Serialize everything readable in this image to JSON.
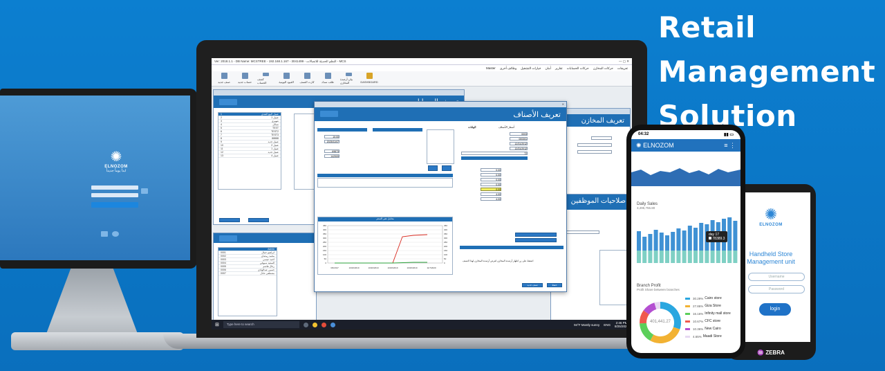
{
  "headline": [
    "Retail",
    "Management",
    "Solution"
  ],
  "monitor": {
    "logo_text": "ELNOZOM",
    "logo_sub": "ابدأ يوماً جديداً"
  },
  "laptop": {
    "window_title": "Ver: 2018.1.1 - DB Name: MCSTREE - 192.168.1.167 - 3041499 - النظم الحديثة للاتصالات - MCS",
    "menu": [
      "تعريفات",
      "حركات المخازن",
      "حركات الحسابات",
      "تقارير",
      "أمان",
      "خيارات التشغيل",
      "وظائف أخرى",
      "Master"
    ],
    "ribbon": [
      "صنف جديد",
      "حساب جديد",
      "كشف الحساب",
      "القيود اليومية",
      "كارت الصنف",
      "طلب سداد",
      "بيان أرصدة المخازن",
      "DASHBOARD"
    ],
    "accounts_window": {
      "title": "تعريف الحسابات",
      "rows": [
        [
          "1",
          "عميل البيع النقدي"
        ],
        [
          "2",
          "عميل 1"
        ],
        [
          "3",
          "شهيري"
        ],
        [
          "4",
          "نسائل"
        ],
        [
          "5",
          "TEST"
        ],
        [
          "6",
          "TEST2"
        ],
        [
          "7",
          "TEST3"
        ],
        [
          "8",
          "88888"
        ],
        [
          "9",
          "عميل جديد"
        ],
        [
          "10",
          "عميل 2"
        ],
        [
          "11",
          "عميل 1"
        ],
        [
          "12",
          "عميل جديد"
        ],
        [
          "13",
          "عميل 4"
        ]
      ]
    },
    "stores_window": {
      "title": "تعريف المخازن"
    },
    "items_window": {
      "title": "تعريف الأصناف",
      "tab_data": "البيانات",
      "tab_prices": "أسعار الأصناف",
      "item_code": "0003",
      "barcode": "000301",
      "date1": "12/31/2012",
      "date2": "12/31/2012",
      "qty": "72",
      "price_fields": [
        "0.00",
        "0.00",
        "0.00",
        "0.00",
        "0.00",
        "4.00",
        "4.00"
      ],
      "chart_title": "معامل تغير السعر",
      "chart_x": [
        "3/6/2017",
        "10/20/2019",
        "10/20/2019",
        "10/26/2019",
        "10/26/2019",
        "11/7/2020"
      ],
      "chart_y": [
        "0",
        "50",
        "100",
        "150",
        "200",
        "250",
        "300",
        "350",
        "400",
        "450"
      ],
      "stores_note": "اضغط على زر اظهار أرصدة المخازن لعرض أرصدة المخازن لهذا الصنف",
      "btn_save": "حفظ",
      "btn_new": "صنف جديد",
      "date_entry": "10:00",
      "entry_date": "2025/11/07",
      "stock": "69873",
      "stock2": "142909"
    },
    "employees_window": {
      "title": "صلاحيات الموظفين"
    },
    "users": [
      "Admin",
      "ابراهيم جمال",
      "محمد رمضان",
      "احمد عيسى",
      "السعيد سيوفي",
      "رجال هاشم",
      "حسين عبدالهادي",
      "مصطفى عادل"
    ],
    "users_codes": [
      "0001",
      "0002",
      "0003",
      "0004",
      "0005",
      "0006",
      "0007"
    ],
    "taskbar": {
      "search": "Type here to search",
      "weather": "94°F  Mostly sunny",
      "lang": "ENG",
      "time": "2:46 PM",
      "date": "8/25/2021"
    }
  },
  "phone": {
    "time": "04:32",
    "brand": "ELNOZOM",
    "daily_sales_title": "Daily Sales",
    "daily_sales_value": "3,495,755.80",
    "tooltip_day": "day 17",
    "tooltip_value": "78389.3",
    "branch_title": "Branch Profit",
    "branch_sub": "Profit Share between branches",
    "donut_center": "401,441.27",
    "branches": [
      {
        "pct": "30.29%",
        "name": "Cairo store",
        "color": "#2aa7e0"
      },
      {
        "pct": "27.86%",
        "name": "Giza Store",
        "color": "#f2b233"
      },
      {
        "pct": "16.16%",
        "name": "Infinity mall store",
        "color": "#5ccf5a"
      },
      {
        "pct": "10.67%",
        "name": "CFC store",
        "color": "#f0594e"
      },
      {
        "pct": "10.36%",
        "name": "New Cairo",
        "color": "#b44fd1"
      },
      {
        "pct": "4.65%",
        "name": "Maadi Store",
        "color": "#e7d9f2"
      }
    ]
  },
  "handheld": {
    "logo": "ELNOZOM",
    "title_line1": "Handheld Store",
    "title_line2": "Management unit",
    "username": "Username",
    "password": "Password",
    "login": "login",
    "brand": "ZEBRA"
  }
}
